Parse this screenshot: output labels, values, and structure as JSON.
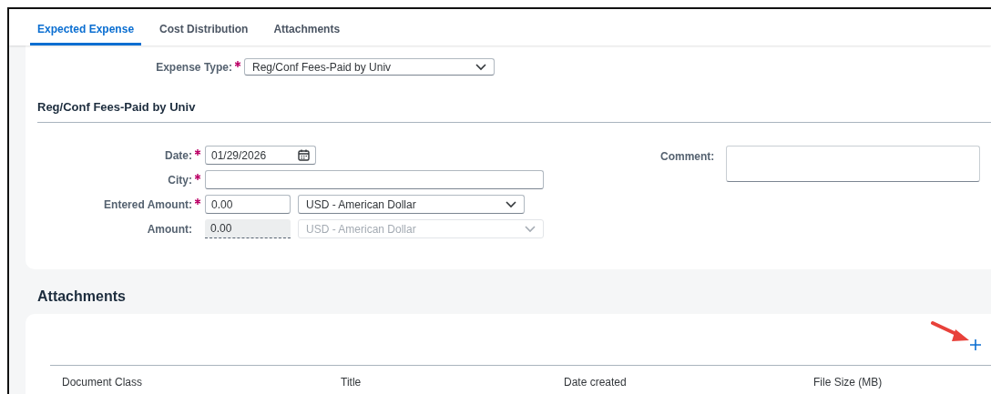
{
  "tabs": [
    {
      "label": "Expected Expense",
      "selected": true
    },
    {
      "label": "Cost Distribution",
      "selected": false
    },
    {
      "label": "Attachments",
      "selected": false
    }
  ],
  "expense_type": {
    "label": "Expense Type:",
    "required": true,
    "value": "Reg/Conf Fees-Paid by Univ"
  },
  "section_title": "Reg/Conf Fees-Paid by Univ",
  "fields": [
    {
      "kind": "date",
      "label": "Date:",
      "required": true,
      "value": "01/29/2026"
    },
    {
      "kind": "text",
      "label": "City:",
      "required": true
    },
    {
      "kind": "amount",
      "label": "Entered Amount:",
      "required": true,
      "value": "0.00",
      "currency": "USD - American Dollar",
      "disabled": false
    },
    {
      "kind": "amount",
      "label": "Amount:",
      "required": false,
      "value": "0.00",
      "currency": "USD - American Dollar",
      "disabled": true
    }
  ],
  "comment": {
    "label": "Comment:"
  },
  "attachments": {
    "title": "Attachments",
    "columns": [
      "Document Class",
      "Title",
      "Date created",
      "File Size (MB)"
    ]
  }
}
